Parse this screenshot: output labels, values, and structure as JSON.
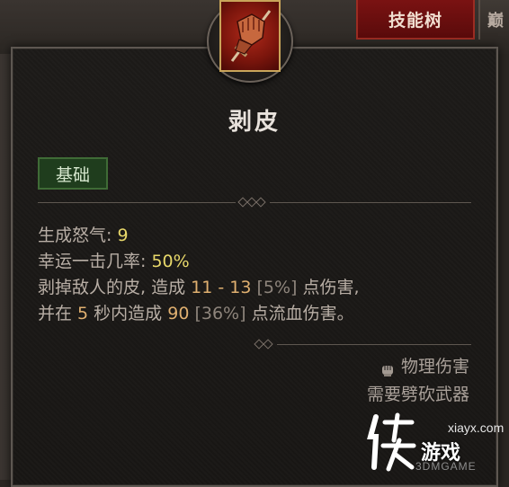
{
  "tabs": {
    "active_label": "技能树",
    "next_label": "巅"
  },
  "skill": {
    "icon": "gauntlet-sword-icon",
    "title": "剥皮",
    "category": "基础"
  },
  "stats": {
    "fury_label": "生成怒气: ",
    "fury_value": "9",
    "lucky_label": "幸运一击几率: ",
    "lucky_value": "50%",
    "desc1_a": "剥掉敌人的皮, 造成 ",
    "desc1_range": "11 - 13",
    "desc1_pct": " [5%]",
    "desc1_b": " 点伤害,",
    "desc2_a": "并在 ",
    "desc2_seconds": "5",
    "desc2_b": " 秒内造成 ",
    "desc2_value": "90",
    "desc2_pct": " [36%]",
    "desc2_c": " 点流血伤害。"
  },
  "meta": {
    "damage_type": "物理伤害",
    "damage_icon": "fist-icon",
    "requirement": "需要劈砍武器"
  },
  "watermark": {
    "domain": "xiayx.com",
    "brand": "游戏",
    "site": "3DMGAME"
  },
  "colors": {
    "accent_red": "#7a1212",
    "value_yellow": "#e8d86a",
    "value_orange": "#e0b070",
    "badge_green": "#1f3d1d"
  }
}
